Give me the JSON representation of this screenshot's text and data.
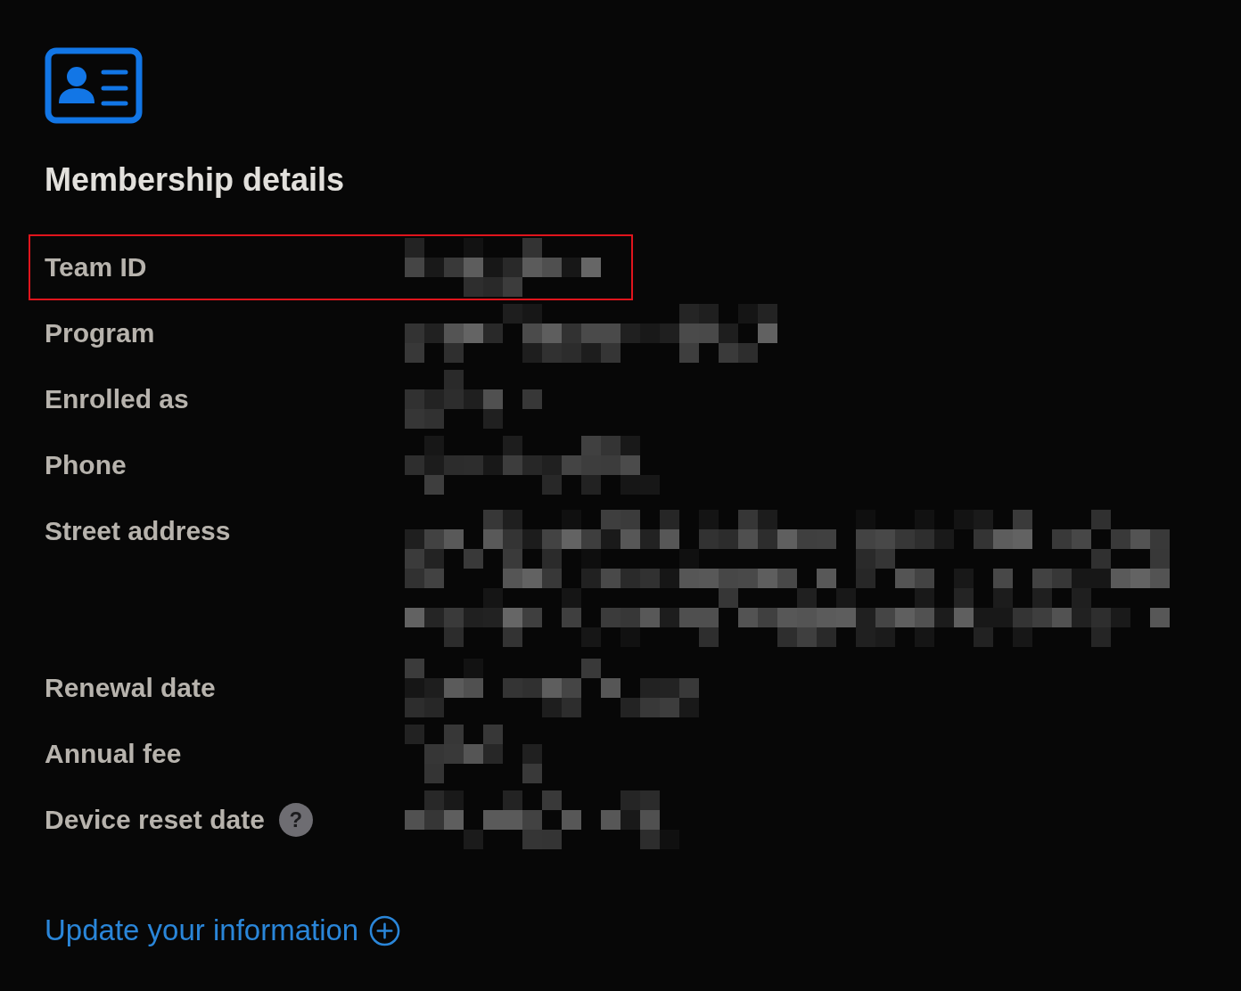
{
  "header": {
    "title": "Membership details"
  },
  "rows": [
    {
      "label": "Team ID",
      "kind": "line",
      "highlighted": true
    },
    {
      "label": "Program",
      "kind": "line",
      "highlighted": false
    },
    {
      "label": "Enrolled as",
      "kind": "line",
      "highlighted": false
    },
    {
      "label": "Phone",
      "kind": "line",
      "highlighted": false
    },
    {
      "label": "Street address",
      "kind": "multiline",
      "highlighted": false
    },
    {
      "label": "Renewal date",
      "kind": "line",
      "highlighted": false
    },
    {
      "label": "Annual fee",
      "kind": "line",
      "highlighted": false
    },
    {
      "label": "Device reset date",
      "kind": "line",
      "highlighted": false,
      "help": "?"
    }
  ],
  "link": {
    "label": "Update your information"
  }
}
